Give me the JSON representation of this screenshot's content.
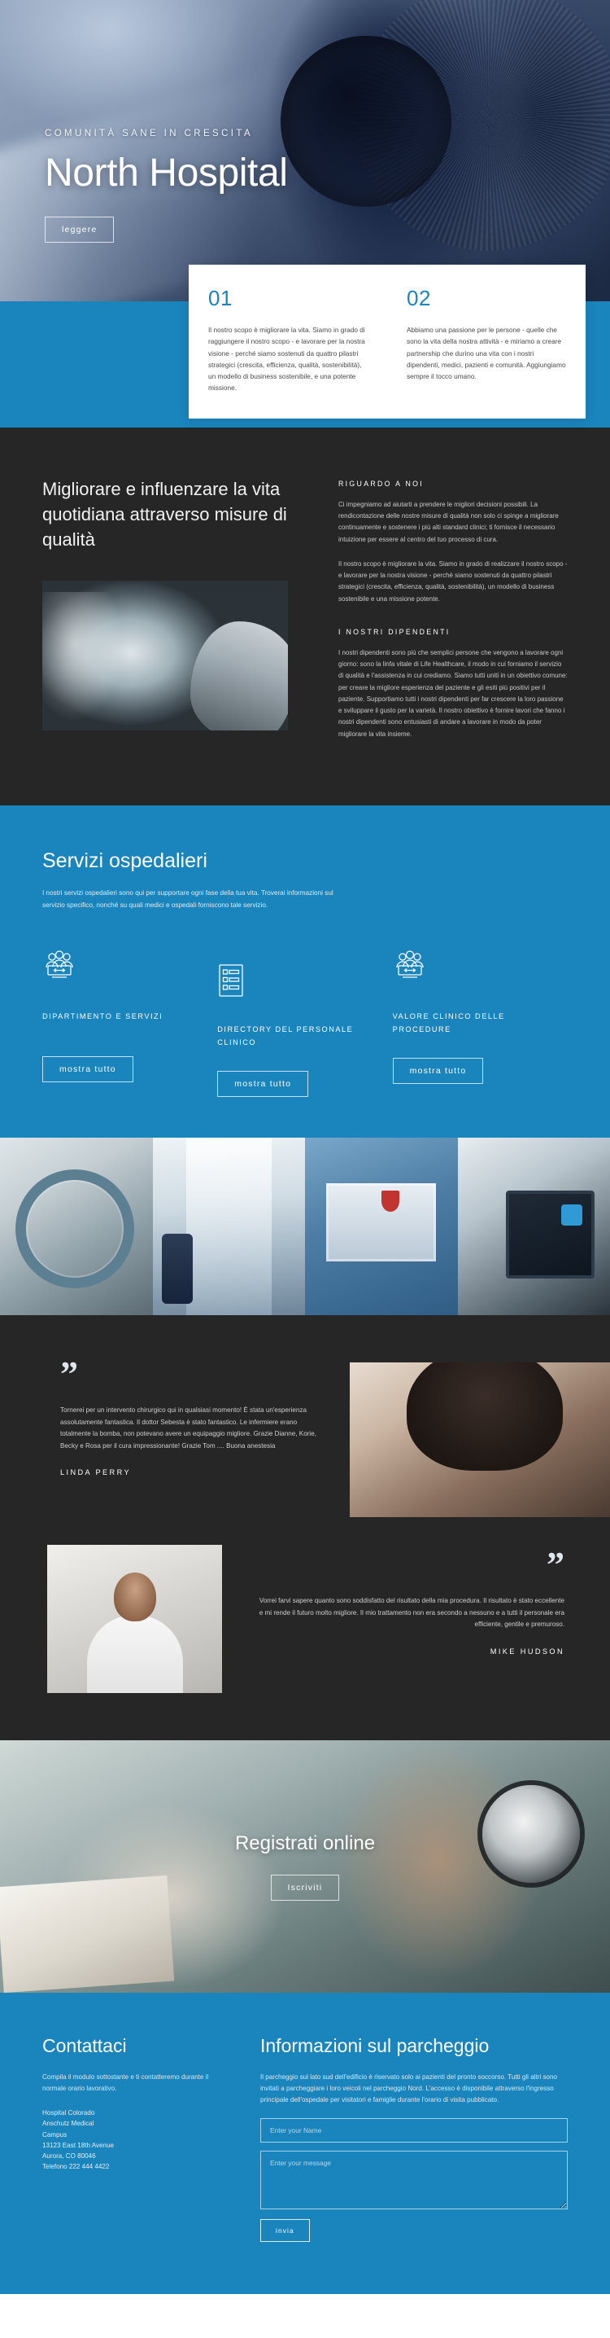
{
  "hero": {
    "eyebrow": "COMUNITÀ SANE IN CRESCITA",
    "title": "North Hospital",
    "button": "leggere"
  },
  "intro_cards": [
    {
      "number": "01",
      "text": "Il nostro scopo è migliorare la vita. Siamo in grado di raggiungere il nostro scopo - e lavorare per la nostra visione - perché siamo sostenuti da quattro pilastri strategici (crescita, efficienza, qualità, sostenibilità), un modello di business sostenibile, e una potente missione."
    },
    {
      "number": "02",
      "text": "Abbiamo una passione per le persone - quelle che sono la vita della nostra attività - e miriamo a creare partnership che durino una vita con i nostri dipendenti, medici, pazienti e comunità. Aggiungiamo sempre il tocco umano."
    }
  ],
  "about": {
    "heading": "Migliorare e influenzare la vita quotidiana attraverso misure di qualità",
    "label_about": "RIGUARDO A NOI",
    "paragraph1": "Ci impegniamo ad aiutarti a prendere le migliori decisioni possibili. La rendicontazione delle nostre misure di qualità non solo ci spinge a migliorare continuamente e sostenere i più alti standard clinici; ti fornisce il necessario intuizione per essere al centro del tuo processo di cura.",
    "paragraph2": "Il nostro scopo è migliorare la vita. Siamo in grado di realizzare il nostro scopo - e lavorare per la nostra visione - perché siamo sostenuti da quattro pilastri strategici (crescita, efficienza, qualità, sostenibilità), un modello di business sostenibile e una missione potente.",
    "label_staff": "I NOSTRI DIPENDENTI",
    "paragraph3": "I nostri dipendenti sono più che semplici persone che vengono a lavorare ogni giorno: sono la linfa vitale di Life Healthcare, il modo in cui forniamo il servizio di qualità e l'assistenza in cui crediamo. Siamo tutti uniti in un obiettivo comune: per creare la migliore esperienza del paziente e gli esiti più positivi per il paziente. Supportiamo tutti i nostri dipendenti per far crescere la loro passione e sviluppare il gusto per la varietà. Il nostro obiettivo è fornire lavori che fanno i nostri dipendenti sono entusiasti di andare a lavorare in modo da poter migliorare la vita insieme."
  },
  "services": {
    "heading": "Servizi ospedalieri",
    "lead": "I nostri servizi ospedalieri sono qui per supportare ogni fase della tua vita. Troverai informazioni sul servizio specifico, nonché su quali medici e ospedali forniscono tale servizio.",
    "items": [
      {
        "icon": "people-group-icon",
        "title": "DIPARTIMENTO E SERVIZI",
        "button": "mostra tutto"
      },
      {
        "icon": "list-document-icon",
        "title": "DIRECTORY DEL PERSONALE CLINICO",
        "button": "mostra tutto"
      },
      {
        "icon": "people-group-icon",
        "title": "VALORE CLINICO DELLE PROCEDURE",
        "button": "mostra tutto"
      }
    ]
  },
  "testimonials": [
    {
      "quote": "Tornerei per un intervento chirurgico qui in qualsiasi momento! È stata un'esperienza assolutamente fantastica. Il dottor Sebesta è stato fantastico. Le infermiere erano totalmente la bomba, non potevano avere un equipaggio migliore. Grazie Dianne, Korie, Becky e Rosa per il cura impressionante! Grazie Tom .... Buona anestesia",
      "author": "LINDA PERRY"
    },
    {
      "quote": "Vorrei farvi sapere quanto sono soddisfatto del risultato della mia procedura. Il risultato è stato eccellente e mi rende il futuro molto migliore. Il mio trattamento non era secondo a nessuno e a tutti il personale era efficiente, gentile e premuroso.",
      "author": "MIKE HUDSON"
    }
  ],
  "register": {
    "heading": "Registrati online",
    "button": "Iscriviti"
  },
  "footer": {
    "contact": {
      "heading": "Contattaci",
      "text": "Compila il modulo sottostante e ti contatteremo durante il normale orario lavorativo.",
      "address": [
        "Hospital Colorado",
        "Anschutz Medical",
        "Campus",
        "13123 East 18th Avenue",
        "Aurora, CO 80046",
        "Telefono 222 444 4422"
      ]
    },
    "parking": {
      "heading": "Informazioni sul parcheggio",
      "text": "Il parcheggio sul lato sud dell'edificio è riservato solo ai pazienti del pronto soccorso. Tutti gli altri sono invitati a parcheggiare i loro veicoli nel parcheggio Nord. L'accesso è disponibile attraverso l'ingresso principale dell'ospedale per visitatori e famiglie durante l'orario di visita pubblicato."
    },
    "form": {
      "name_placeholder": "Enter your Name",
      "message_placeholder": "Enter your message",
      "submit": "invia"
    }
  },
  "colors": {
    "accent_blue": "#1a84bd",
    "dark": "#262626",
    "white": "#ffffff"
  }
}
